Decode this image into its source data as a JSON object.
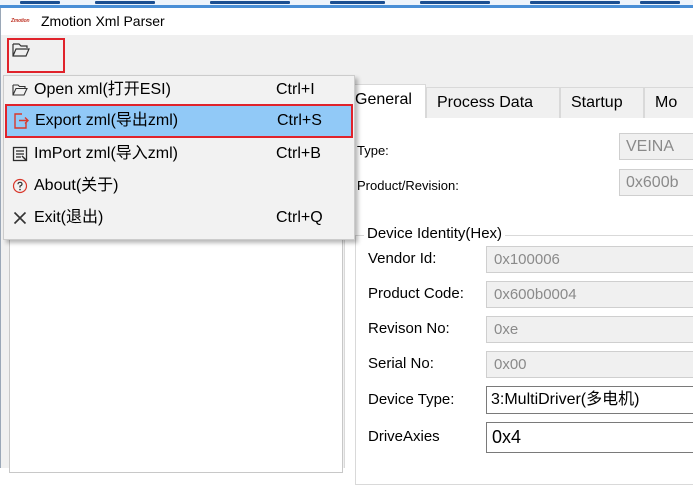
{
  "window": {
    "title": "Zmotion Xml Parser",
    "logo_text": "Zmotion"
  },
  "toolbar": {
    "open_folder_icon": "folder-open-icon"
  },
  "menu": {
    "items": [
      {
        "label": "Open xml(打开ESI)",
        "shortcut": "Ctrl+I",
        "icon": "folder-open-icon"
      },
      {
        "label": "Export zml(导出zml)",
        "shortcut": "Ctrl+S",
        "icon": "export-icon",
        "highlighted": true
      },
      {
        "label": "ImPort zml(导入zml)",
        "shortcut": "Ctrl+B",
        "icon": "import-icon"
      },
      {
        "label": "About(关于)",
        "shortcut": "",
        "icon": "help-circle-icon"
      },
      {
        "label": "Exit(退出)",
        "shortcut": "Ctrl+Q",
        "icon": "close-icon"
      }
    ]
  },
  "tabs": [
    {
      "label": "General",
      "active": true
    },
    {
      "label": "Process Data",
      "active": false
    },
    {
      "label": "Startup",
      "active": false
    },
    {
      "label": "Mo",
      "active": false
    }
  ],
  "general": {
    "type_label": "Type:",
    "type_value": "VEINA",
    "product_revision_label": "Product/Revision:",
    "product_revision_value": "0x600b",
    "device_identity_title": "Device Identity(Hex)",
    "vendor_id_label": "Vendor Id:",
    "vendor_id_value": "0x100006",
    "product_code_label": "Product Code:",
    "product_code_value": "0x600b0004",
    "revison_no_label": "Revison No:",
    "revison_no_value": "0xe",
    "serial_no_label": "Serial No:",
    "serial_no_value": "0x00",
    "device_type_label": "Device Type:",
    "device_type_value": "3:MultiDriver(多电机)",
    "drive_axies_label": "DriveAxies",
    "drive_axies_value": "0x4"
  },
  "colors": {
    "highlight": "#91c9f7",
    "annotation_red": "#e0232b",
    "window_bg": "#f0f0f0"
  }
}
